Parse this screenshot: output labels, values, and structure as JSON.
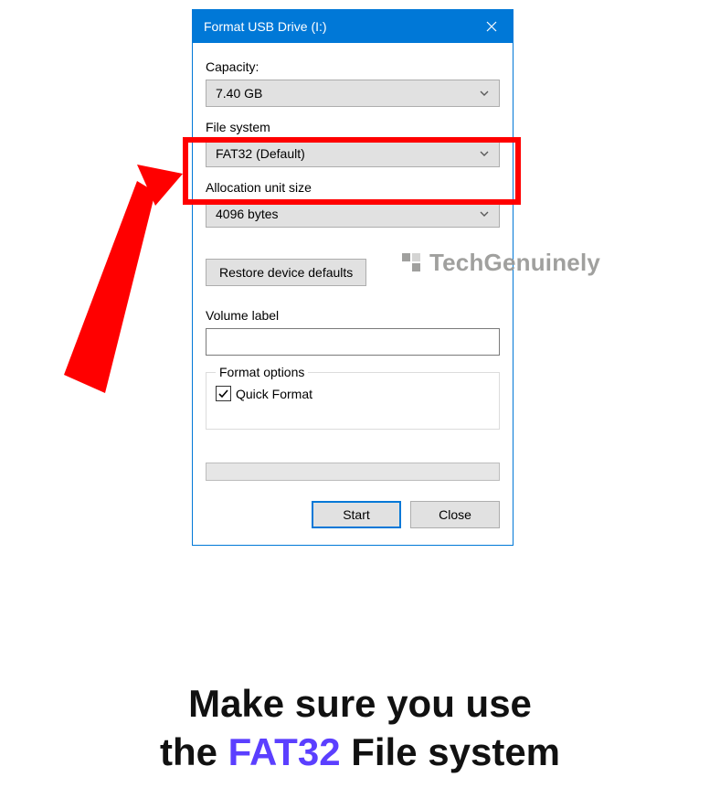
{
  "dialog": {
    "title": "Format USB Drive (I:)",
    "capacity_label": "Capacity:",
    "capacity_value": "7.40 GB",
    "filesystem_label": "File system",
    "filesystem_value": "FAT32 (Default)",
    "allocation_label": "Allocation unit size",
    "allocation_value": "4096 bytes",
    "restore_defaults": "Restore device defaults",
    "volume_label_label": "Volume label",
    "volume_label_value": "",
    "format_options_title": "Format options",
    "quick_format_label": "Quick Format",
    "quick_format_checked": true,
    "start_label": "Start",
    "close_label": "Close"
  },
  "watermark": "TechGenuinely",
  "caption": {
    "line1_pre": "Make sure you use",
    "line2_pre": "the ",
    "line2_em": "FAT32",
    "line2_post": " File system"
  },
  "colors": {
    "accent": "#0078d7",
    "highlight": "#ff0000",
    "emphasis": "#5b3fff"
  }
}
